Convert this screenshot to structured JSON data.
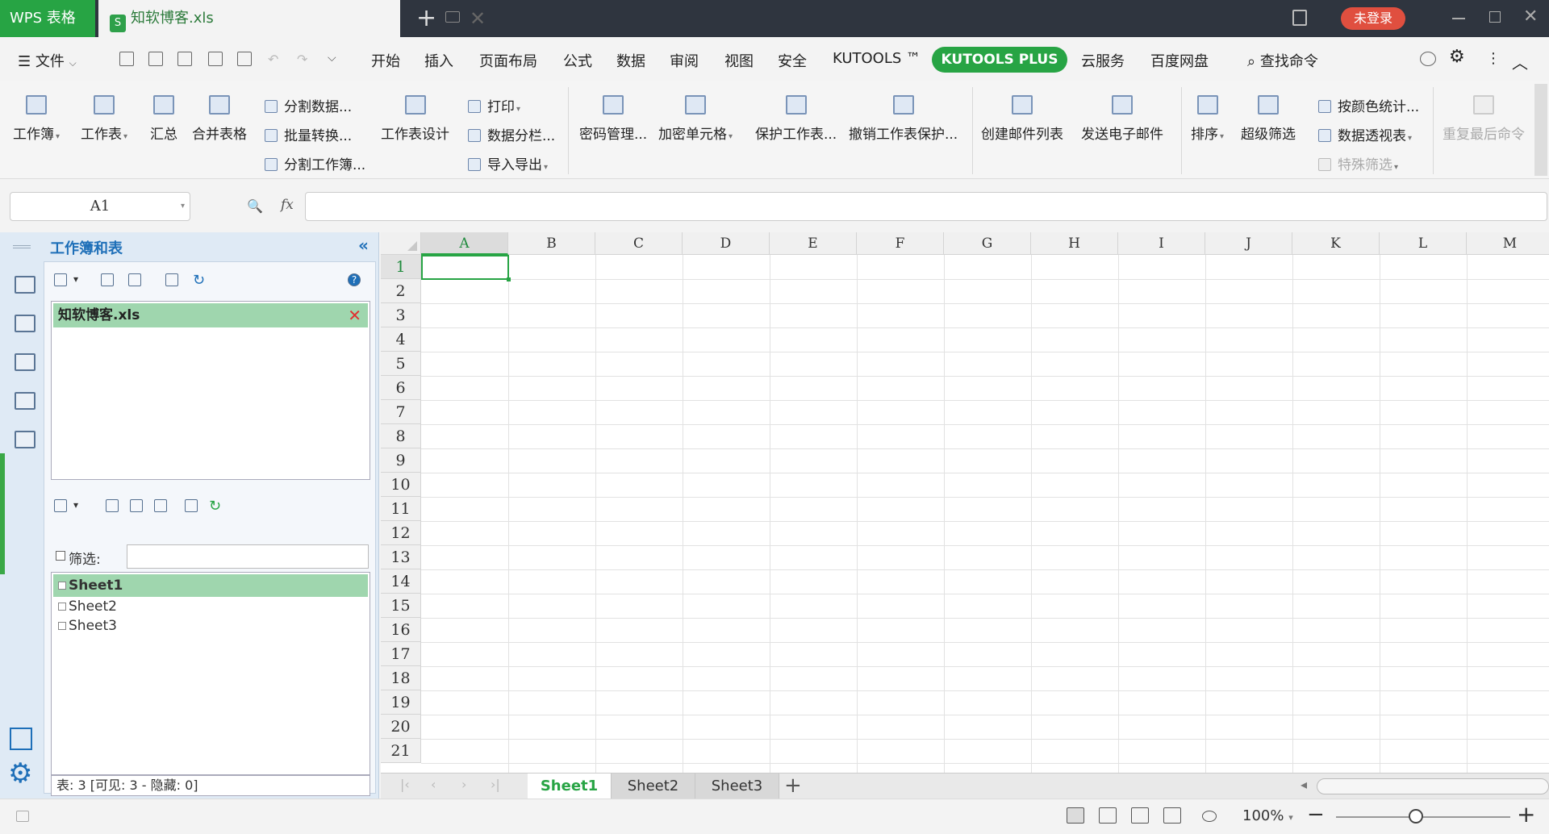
{
  "titlebar": {
    "app_name": "WPS 表格",
    "file_tab": "知软博客.xls",
    "login_label": "未登录"
  },
  "menubar": {
    "file_label": "文件",
    "tabs": [
      "开始",
      "插入",
      "页面布局",
      "公式",
      "数据",
      "审阅",
      "视图",
      "安全",
      "KUTOOLS ™",
      "KUTOOLS PLUS",
      "云服务",
      "百度网盘"
    ],
    "active_tab": "KUTOOLS PLUS",
    "search_label": "查找命令"
  },
  "ribbon": {
    "workbook": "工作簿",
    "worksheet": "工作表",
    "summary": "汇总",
    "merge_table": "合并表格",
    "split_data": "分割数据...",
    "batch_convert": "批量转换...",
    "split_workbook": "分割工作簿...",
    "sheet_design": "工作表设计",
    "print": "打印",
    "data_columns": "数据分栏...",
    "import_export": "导入导出",
    "password_manager": "密码管理...",
    "encrypt_cells": "加密单元格",
    "protect_sheet": "保护工作表...",
    "unprotect_sheet": "撤销工作表保护...",
    "create_mail_list": "创建邮件列表",
    "send_email": "发送电子邮件",
    "sort": "排序",
    "super_filter": "超级筛选",
    "count_by_color": "按颜色统计...",
    "pivot_table": "数据透视表",
    "special_filter": "特殊筛选",
    "repeat_last": "重复最后命令"
  },
  "formulabar": {
    "cell_ref": "A1",
    "fx": "fx",
    "formula": ""
  },
  "sidepanel": {
    "title": "工作簿和表",
    "workbook_item": "知软博客.xls",
    "filter_label": "筛选:",
    "sheets": [
      "Sheet1",
      "Sheet2",
      "Sheet3"
    ],
    "active_sheet": "Sheet1",
    "status": "表: 3  [可见: 3 - 隐藏: 0]"
  },
  "grid": {
    "columns": [
      "A",
      "B",
      "C",
      "D",
      "E",
      "F",
      "G",
      "H",
      "I",
      "J",
      "K",
      "L",
      "M"
    ],
    "rows": [
      "1",
      "2",
      "3",
      "4",
      "5",
      "6",
      "7",
      "8",
      "9",
      "10",
      "11",
      "12",
      "13",
      "14",
      "15",
      "16",
      "17",
      "18",
      "19",
      "20",
      "21"
    ],
    "selected_cell": "A1"
  },
  "sheettabs": {
    "tabs": [
      "Sheet1",
      "Sheet2",
      "Sheet3"
    ],
    "active": "Sheet1"
  },
  "statusbar": {
    "zoom": "100%",
    "zoom_level_percent": 100
  },
  "colors": {
    "accent_green": "#27a444",
    "titlebar_bg": "#2f353f",
    "login_red": "#e04f3f"
  }
}
